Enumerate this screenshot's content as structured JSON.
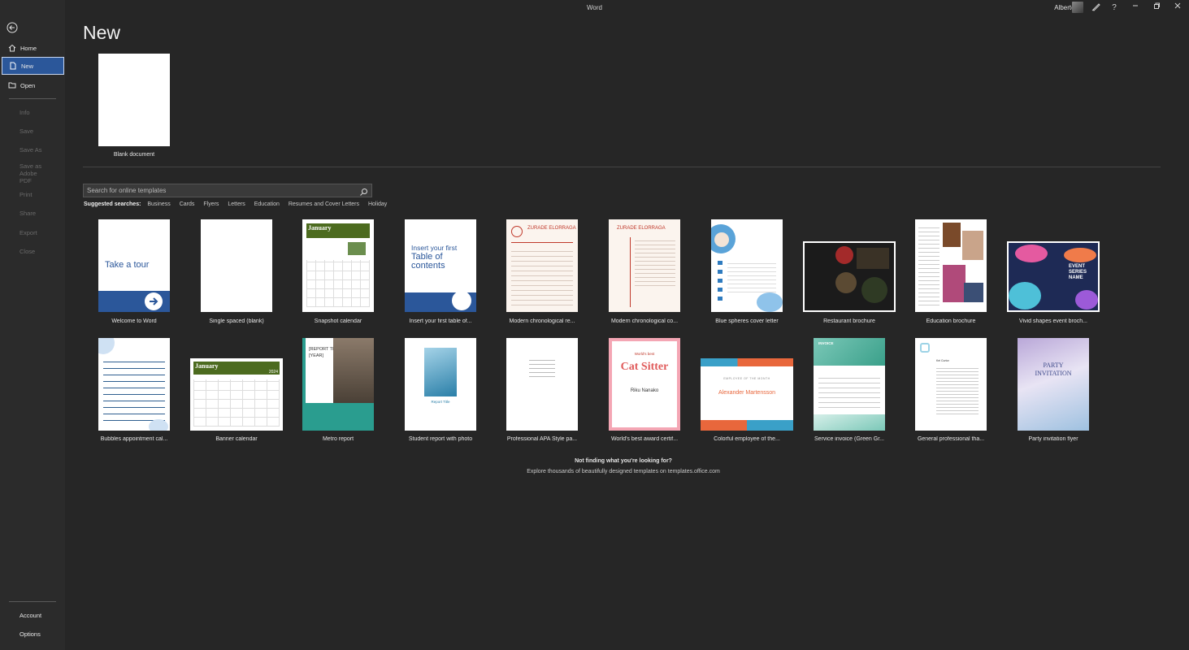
{
  "window": {
    "app_title": "Word",
    "user_name": "Alberto G",
    "controls": [
      "pen-icon",
      "help-icon",
      "minimize-icon",
      "restore-icon",
      "close-icon"
    ]
  },
  "sidebar": {
    "back_icon": "back-arrow-icon",
    "items": [
      {
        "label": "Home",
        "icon": "home-icon",
        "state": "normal"
      },
      {
        "label": "New",
        "icon": "new-doc-icon",
        "state": "active"
      },
      {
        "label": "Open",
        "icon": "folder-open-icon",
        "state": "normal"
      },
      {
        "label": "Info",
        "state": "disabled"
      },
      {
        "label": "Save",
        "state": "disabled"
      },
      {
        "label": "Save As",
        "state": "disabled"
      },
      {
        "label": "Save as Adobe PDF",
        "state": "disabled"
      },
      {
        "label": "Print",
        "state": "disabled"
      },
      {
        "label": "Share",
        "state": "disabled"
      },
      {
        "label": "Export",
        "state": "disabled"
      },
      {
        "label": "Close",
        "state": "disabled"
      }
    ],
    "bottom_items": [
      {
        "label": "Account"
      },
      {
        "label": "Options"
      }
    ]
  },
  "main": {
    "title": "New",
    "blank": {
      "label": "Blank document"
    },
    "search": {
      "placeholder": "Search for online templates",
      "icon": "search-icon"
    },
    "suggested": {
      "label": "Suggested searches:",
      "tags": [
        "Business",
        "Cards",
        "Flyers",
        "Letters",
        "Education",
        "Resumes and Cover Letters",
        "Holiday"
      ]
    },
    "templates_row1": [
      {
        "label": "Welcome to Word",
        "preview_text": "Take a tour"
      },
      {
        "label": "Single spaced (blank)"
      },
      {
        "label": "Snapshot calendar",
        "preview_text": "January",
        "year": "2024"
      },
      {
        "label": "Insert your first table of...",
        "preview_lines": [
          "Insert your first",
          "Table of",
          "contents"
        ]
      },
      {
        "label": "Modern chronological re...",
        "preview_text": "ZURADE ELORRAGA"
      },
      {
        "label": "Modern chronological co...",
        "preview_text": "ZURADE ELORRAGA"
      },
      {
        "label": "Blue spheres cover letter"
      },
      {
        "label": "Restaurant brochure"
      },
      {
        "label": "Education brochure"
      },
      {
        "label": "Vivid shapes event broch...",
        "preview_lines": [
          "EVENT",
          "SERIES",
          "NAME"
        ]
      }
    ],
    "templates_row2": [
      {
        "label": "Bubbles appointment cal..."
      },
      {
        "label": "Banner calendar",
        "preview_text": "January",
        "year": "2024"
      },
      {
        "label": "Metro report",
        "preview_lines": [
          "[REPORT TITLE]",
          "[YEAR]"
        ]
      },
      {
        "label": "Student report with photo",
        "preview_text": "Report Title"
      },
      {
        "label": "Professional APA Style pa..."
      },
      {
        "label": "World's best award certif...",
        "preview_badge": "World's best",
        "preview_text": "Cat Sitter",
        "preview_name": "Riku Nanako"
      },
      {
        "label": "Colorful employee of the...",
        "preview_caption": "EMPLOYEE OF THE MONTH",
        "preview_text": "Alexander Martensson"
      },
      {
        "label": "Service invoice (Green Gr...",
        "preview_text": "INVOICE"
      },
      {
        "label": "General professional tha...",
        "preview_text": "Kei Curtor"
      },
      {
        "label": "Party invitation flyer",
        "preview_lines": [
          "PARTY",
          "INVITATION"
        ]
      }
    ],
    "footer": {
      "headline": "Not finding what you're looking for?",
      "subline": "Explore thousands of beautifully designed templates on templates.office.com"
    }
  },
  "colors": {
    "accent": "#2b579a",
    "background": "#262626",
    "sidebar": "#2b2b2b"
  }
}
